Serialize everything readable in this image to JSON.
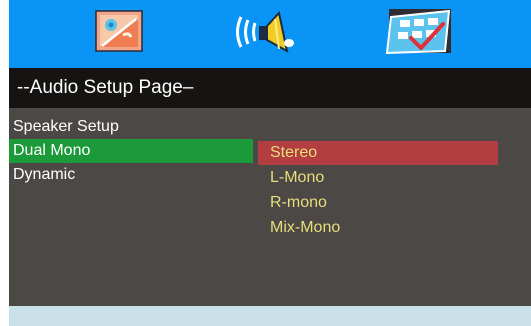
{
  "tabs": [
    {
      "icon": "general-setup-icon"
    },
    {
      "icon": "audio-speaker-icon"
    },
    {
      "icon": "preference-checkbox-icon"
    }
  ],
  "page_title": "--Audio Setup Page–",
  "menu": [
    {
      "label": "Speaker  Setup",
      "selected": false
    },
    {
      "label": "Dual  Mono",
      "selected": true
    },
    {
      "label": "Dynamic",
      "selected": false
    }
  ],
  "options": [
    {
      "label": "Stereo",
      "selected": true
    },
    {
      "label": "L-Mono",
      "selected": false
    },
    {
      "label": "R-mono",
      "selected": false
    },
    {
      "label": "Mix-Mono",
      "selected": false
    }
  ],
  "colors": {
    "top_bar": "#0a94f5",
    "title_bar": "#151412",
    "panel": "#4c4845",
    "menu_highlight": "#1c9a3a",
    "option_highlight": "#b23e41",
    "option_text": "#e7de7a",
    "status_bar": "#c9e0e8"
  }
}
